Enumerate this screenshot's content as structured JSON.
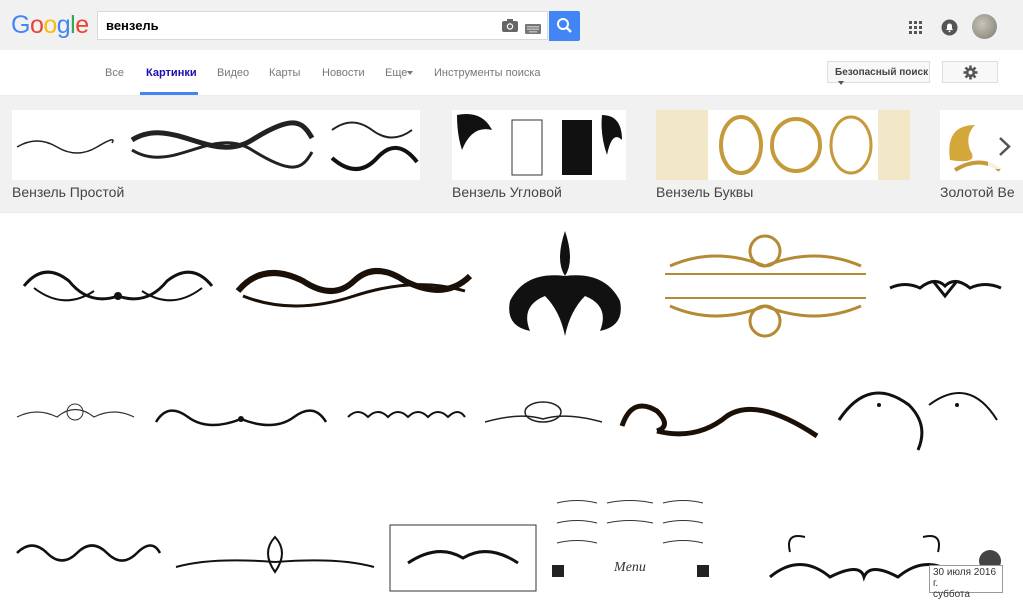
{
  "logo": {
    "letters": [
      "G",
      "o",
      "o",
      "g",
      "l",
      "e"
    ],
    "colors": [
      "#4285f4",
      "#ea4335",
      "#fbbc05",
      "#4285f4",
      "#34a853",
      "#ea4335"
    ]
  },
  "search": {
    "value": "вензель"
  },
  "tabs": [
    {
      "label": "Все",
      "active": false
    },
    {
      "label": "Картинки",
      "active": true
    },
    {
      "label": "Видео",
      "active": false
    },
    {
      "label": "Карты",
      "active": false
    },
    {
      "label": "Новости",
      "active": false
    },
    {
      "label": "Еще",
      "active": false
    },
    {
      "label": "Инструменты поиска",
      "active": false
    }
  ],
  "safe_search": "Безопасный поиск",
  "related": [
    {
      "label": "Вензель Простой"
    },
    {
      "label": "Вензель Угловой"
    },
    {
      "label": "Вензель Буквы"
    },
    {
      "label": "Золотой Ве"
    }
  ],
  "tooltip": {
    "line1": "30 июля 2016 г.",
    "line2": "суббота"
  },
  "icons": {
    "camera": "camera-icon",
    "keyboard": "keyboard-icon",
    "search": "search-icon",
    "apps": "apps-grid-icon",
    "notifications": "notifications-icon",
    "settings": "gear-icon",
    "next": "chevron-right-icon",
    "dropdown": "caret-down-icon",
    "avatar": "avatar"
  }
}
